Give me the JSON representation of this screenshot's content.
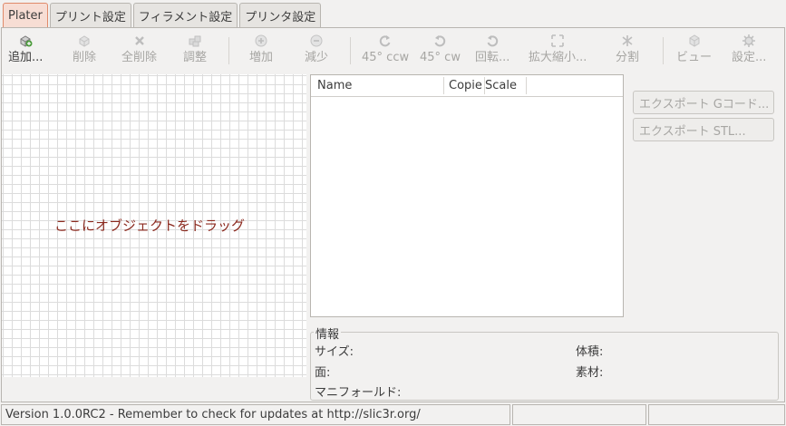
{
  "tabs": [
    {
      "label": "Plater",
      "active": true
    },
    {
      "label": "プリント設定",
      "active": false
    },
    {
      "label": "フィラメント設定",
      "active": false
    },
    {
      "label": "プリンタ設定",
      "active": false
    }
  ],
  "toolbar": {
    "add": {
      "label": "追加...",
      "icon": "add-object-icon",
      "enabled": true
    },
    "delete": {
      "label": "削除",
      "icon": "delete-object-icon",
      "enabled": false
    },
    "delete_all": {
      "label": "全削除",
      "icon": "delete-all-icon",
      "enabled": false
    },
    "arrange": {
      "label": "調整",
      "icon": "arrange-icon",
      "enabled": false
    },
    "increase": {
      "label": "増加",
      "icon": "plus-icon",
      "enabled": false
    },
    "decrease": {
      "label": "減少",
      "icon": "minus-icon",
      "enabled": false
    },
    "rotate_ccw": {
      "label": "45° ccw",
      "icon": "rotate-ccw-icon",
      "enabled": false
    },
    "rotate_cw": {
      "label": "45° cw",
      "icon": "rotate-cw-icon",
      "enabled": false
    },
    "rotate": {
      "label": "回転...",
      "icon": "rotate-icon",
      "enabled": false
    },
    "scale": {
      "label": "拡大縮小...",
      "icon": "scale-icon",
      "enabled": false
    },
    "split": {
      "label": "分割",
      "icon": "split-icon",
      "enabled": false
    },
    "view": {
      "label": "ビュー",
      "icon": "view-icon",
      "enabled": false
    },
    "settings": {
      "label": "設定...",
      "icon": "settings-icon",
      "enabled": false
    }
  },
  "canvas": {
    "hint": "ここにオブジェクトをドラッグ"
  },
  "object_list": {
    "columns": [
      "Name",
      "Copie",
      "Scale"
    ],
    "rows": []
  },
  "export": {
    "gcode": "エクスポート Gコード...",
    "stl": "エクスポート STL..."
  },
  "info": {
    "title": "情報",
    "size": "サイズ:",
    "volume": "体積:",
    "facets": "面:",
    "material": "素材:",
    "manifold": "マニフォールド:"
  },
  "status": {
    "message": "Version 1.0.0RC2 - Remember to check for updates at http://slic3r.org/",
    "field2": "",
    "field3": ""
  },
  "colors": {
    "active_tab_bg": "#f7ddd4",
    "active_tab_border": "#e08a6a",
    "hint_text": "#8b2a1f",
    "disabled_text": "#a7a6a3"
  }
}
